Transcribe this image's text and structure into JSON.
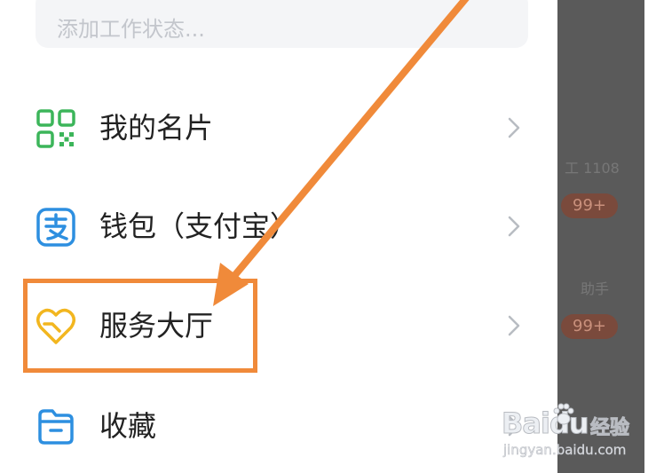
{
  "status_input": {
    "placeholder": "添加工作状态..."
  },
  "menu": [
    {
      "label": "我的名片",
      "icon": "qr-code-icon",
      "color": "#3cb55a"
    },
    {
      "label": "钱包（支付宝）",
      "icon": "alipay-wallet-icon",
      "color": "#2d8fe0"
    },
    {
      "label": "服务大厅",
      "icon": "heart-service-icon",
      "color": "#f2b61f"
    },
    {
      "label": "收藏",
      "icon": "folder-icon",
      "color": "#2d8fe0"
    }
  ],
  "side_list": {
    "badges": [
      "99+",
      "99+"
    ],
    "snippets": [
      "工 1108",
      "助手"
    ]
  },
  "annotation": {
    "color": "#f08a3a"
  },
  "watermark": {
    "logo": "Baidu",
    "name": "经验",
    "url": "jingyan.baidu.com"
  }
}
